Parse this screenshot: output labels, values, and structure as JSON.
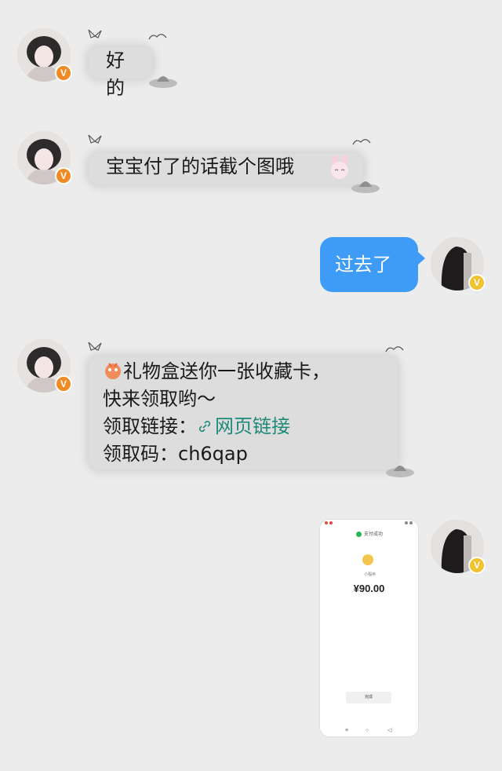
{
  "messages": [
    {
      "side": "left",
      "text": "好的"
    },
    {
      "side": "left",
      "text": "宝宝付了的话截个图哦"
    },
    {
      "side": "right",
      "text": "过去了"
    },
    {
      "side": "left",
      "lines": [
        "礼物盒送你一张收藏卡，",
        "快来领取哟～",
        "领取链接：",
        "领取码：ch6qap"
      ],
      "link_label": "网页链接"
    },
    {
      "side": "right",
      "type": "image"
    }
  ],
  "badges": {
    "verified": "V"
  },
  "screenshot": {
    "header": "支付成功",
    "subtitle": "小程序",
    "amount": "¥90.00",
    "button": "完成",
    "nav": [
      "≡",
      "○",
      "◁"
    ]
  },
  "colors": {
    "background": "#ececec",
    "right_bubble": "#3f9cf6",
    "link": "#1f8a7a",
    "badge_orange": "#f08a24",
    "badge_yellow": "#f2c12e"
  }
}
